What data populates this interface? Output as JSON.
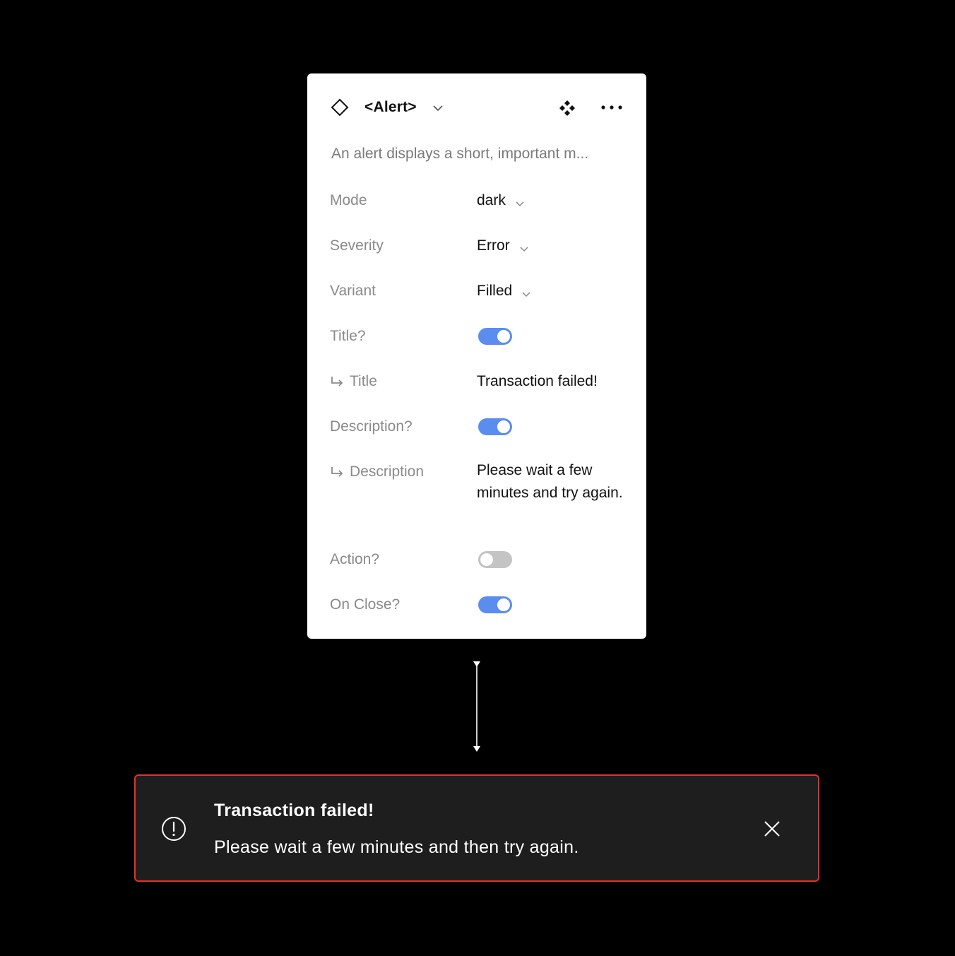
{
  "panel": {
    "component_name": "<Alert>",
    "component_icon": "diamond-icon",
    "description": "An alert displays a short, important m...",
    "header_icons": [
      "chevron-down-icon",
      "instance-icon",
      "more-icon"
    ],
    "props": {
      "mode": {
        "label": "Mode",
        "value": "dark"
      },
      "severity": {
        "label": "Severity",
        "value": "Error"
      },
      "variant": {
        "label": "Variant",
        "value": "Filled"
      },
      "title_toggle": {
        "label": "Title?",
        "on": true
      },
      "title_text": {
        "label": "Title",
        "value": "Transaction failed!"
      },
      "description_toggle": {
        "label": "Description?",
        "on": true
      },
      "description_text": {
        "label": "Description",
        "value": "Please wait a few minutes and try again."
      },
      "action_toggle": {
        "label": "Action?",
        "on": false
      },
      "onclose_toggle": {
        "label": "On Close?",
        "on": true
      }
    },
    "toggle_on_color": "#5b8def"
  },
  "alert": {
    "title": "Transaction failed!",
    "description": "Please wait a few minutes and then try again.",
    "icon": "error-circle-icon",
    "close_icon": "close-icon",
    "border_color": "#e1322c",
    "background_color": "#1e1e1e"
  }
}
